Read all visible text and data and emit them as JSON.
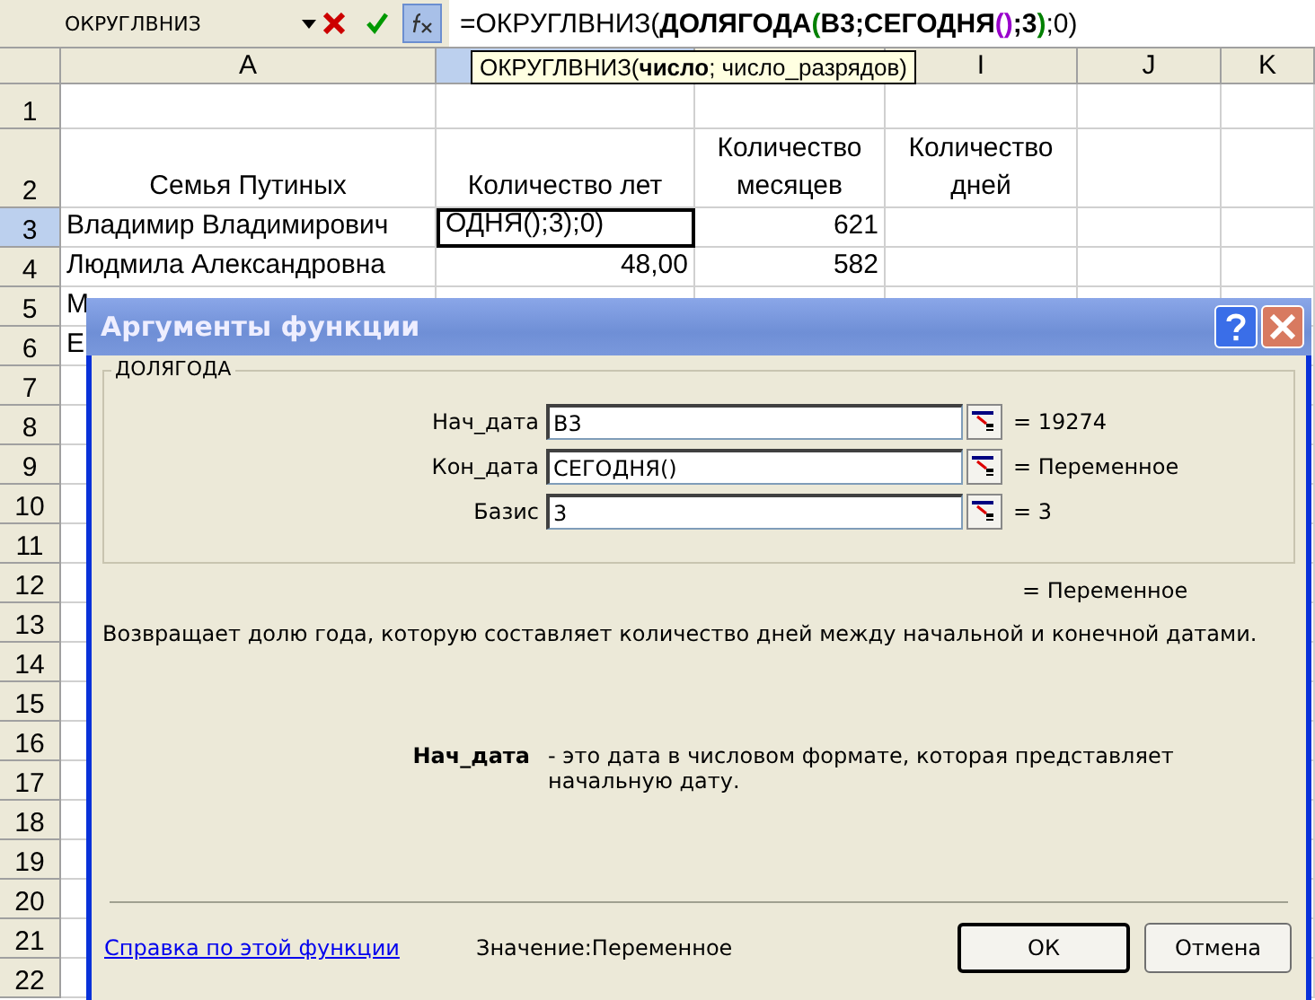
{
  "formula_bar": {
    "name_box": "ОКРУГЛВНИЗ",
    "formula": [
      {
        "text": "=ОКРУГЛВНИЗ(",
        "bold": false
      },
      {
        "text": "ДОЛЯГОДА",
        "bold": true
      },
      {
        "text": "(",
        "bold": true,
        "color": "#008000"
      },
      {
        "text": "В3;СЕГОДНЯ",
        "bold": true
      },
      {
        "text": "()",
        "bold": true,
        "color": "#9900cc"
      },
      {
        "text": ";3",
        "bold": true
      },
      {
        "text": ")",
        "bold": true,
        "color": "#008000"
      },
      {
        "text": ";0)",
        "bold": false
      }
    ]
  },
  "tooltip": "ОКРУГЛВНИЗ(**число**; число_разрядов)",
  "columns": [
    {
      "label": "A",
      "selected": false
    },
    {
      "selected": true
    },
    {
      "selected": false
    },
    {
      "label": "I",
      "selected": false
    },
    {
      "label": "J",
      "selected": false
    },
    {
      "label": "K",
      "selected": false
    }
  ],
  "rows": [
    {
      "number": "1",
      "selected": false,
      "cells": {}
    },
    {
      "number": "2",
      "selected": false,
      "cells": {
        "column_1": {
          "text": "Семья Путиных",
          "kind": "header"
        },
        "column_2": {
          "text": "Количество лет",
          "kind": "header"
        },
        "column_3": {
          "text": "Количество месяцев",
          "kind": "header"
        },
        "column_4": {
          "text": "Количество дней",
          "kind": "header"
        }
      }
    },
    {
      "number": "3",
      "selected": true,
      "cells": {
        "column_1": {
          "text": "Владимир Владимирович",
          "kind": "text"
        },
        "column_2": {
          "text": "ОДНЯ();3);0)",
          "kind": "text",
          "active": true
        },
        "column_3": {
          "text": "621",
          "kind": "number"
        }
      }
    },
    {
      "number": "4",
      "selected": false,
      "cells": {
        "column_1": {
          "text": "Людмила Александровна",
          "kind": "text"
        },
        "column_2": {
          "text": "48,00",
          "kind": "number"
        },
        "column_3": {
          "text": "582",
          "kind": "number"
        }
      }
    },
    {
      "number": "5",
      "selected": false,
      "cells": {
        "column_1": {
          "text": "М",
          "kind": "text"
        }
      }
    },
    {
      "number": "6",
      "selected": false,
      "cells": {
        "column_1": {
          "text": "Е",
          "kind": "text"
        }
      }
    },
    {
      "number": "7",
      "selected": false,
      "cells": {}
    },
    {
      "number": "8",
      "selected": false,
      "cells": {}
    },
    {
      "number": "9",
      "selected": false,
      "cells": {}
    },
    {
      "number": "10",
      "selected": false,
      "cells": {}
    },
    {
      "number": "11",
      "selected": false,
      "cells": {}
    },
    {
      "number": "12",
      "selected": false,
      "cells": {}
    },
    {
      "number": "13",
      "selected": false,
      "cells": {}
    },
    {
      "number": "14",
      "selected": false,
      "cells": {}
    },
    {
      "number": "15",
      "selected": false,
      "cells": {}
    },
    {
      "number": "16",
      "selected": false,
      "cells": {}
    },
    {
      "number": "17",
      "selected": false,
      "cells": {}
    },
    {
      "number": "18",
      "selected": false,
      "cells": {}
    },
    {
      "number": "19",
      "selected": false,
      "cells": {}
    },
    {
      "number": "20",
      "selected": false,
      "cells": {}
    },
    {
      "number": "21",
      "selected": false,
      "cells": {}
    },
    {
      "number": "22",
      "selected": false,
      "cells": {}
    }
  ],
  "dialog": {
    "title": "Аргументы функции",
    "function_name": "ДОЛЯГОДА",
    "arguments": [
      {
        "label": "Нач_дата",
        "value": "В3",
        "result": "= 19274"
      },
      {
        "label": "Кон_дата",
        "value": "СЕГОДНЯ()",
        "result": "= Переменное"
      },
      {
        "label": "Базис",
        "value": "3",
        "result": "= 3"
      }
    ],
    "result": "= Переменное",
    "description": "Возвращает долю года, которую составляет количество дней между начальной и конечной датами.",
    "argument_help": {
      "label": "Нач_дата",
      "text": "- это дата в числовом формате, которая представляет начальную дату."
    },
    "help_link": "Справка по этой функции",
    "value": "Значение:Переменное",
    "buttons": [
      {
        "label": "ОК",
        "default": true
      },
      {
        "label": "Отмена",
        "default": false
      }
    ]
  }
}
